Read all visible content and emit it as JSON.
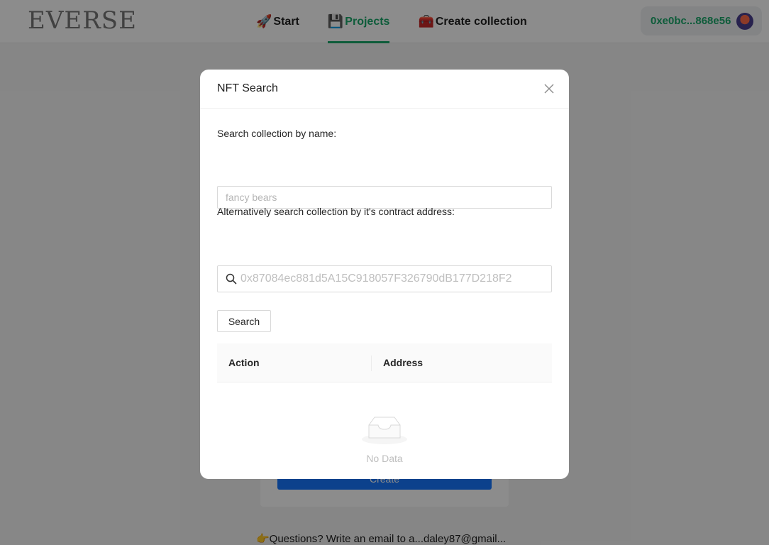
{
  "header": {
    "logo": "EVERSE",
    "nav": [
      {
        "emoji": "🚀",
        "label": "Start",
        "active": false
      },
      {
        "emoji": "💾",
        "label": "Projects",
        "active": true
      },
      {
        "emoji": "🧰",
        "label": "Create collection",
        "active": false
      }
    ],
    "wallet_address": "0xe0bc...868e56"
  },
  "background": {
    "create_button": "Create",
    "footer_text": "👉Questions? Write an email to a...daley87@gmail..."
  },
  "modal": {
    "title": "NFT Search",
    "name_label": "Search collection by name:",
    "name_placeholder": "fancy bears",
    "address_label": "Alternatively search collection by it's contract address:",
    "address_placeholder": "0x87084ec881d5A15C918057F326790dB177D218F2",
    "search_button": "Search",
    "table": {
      "columns": [
        "Action",
        "Address"
      ],
      "rows": [],
      "empty_text": "No Data"
    }
  },
  "colors": {
    "accent": "#1aa86b",
    "primary_button": "#1677ff"
  }
}
